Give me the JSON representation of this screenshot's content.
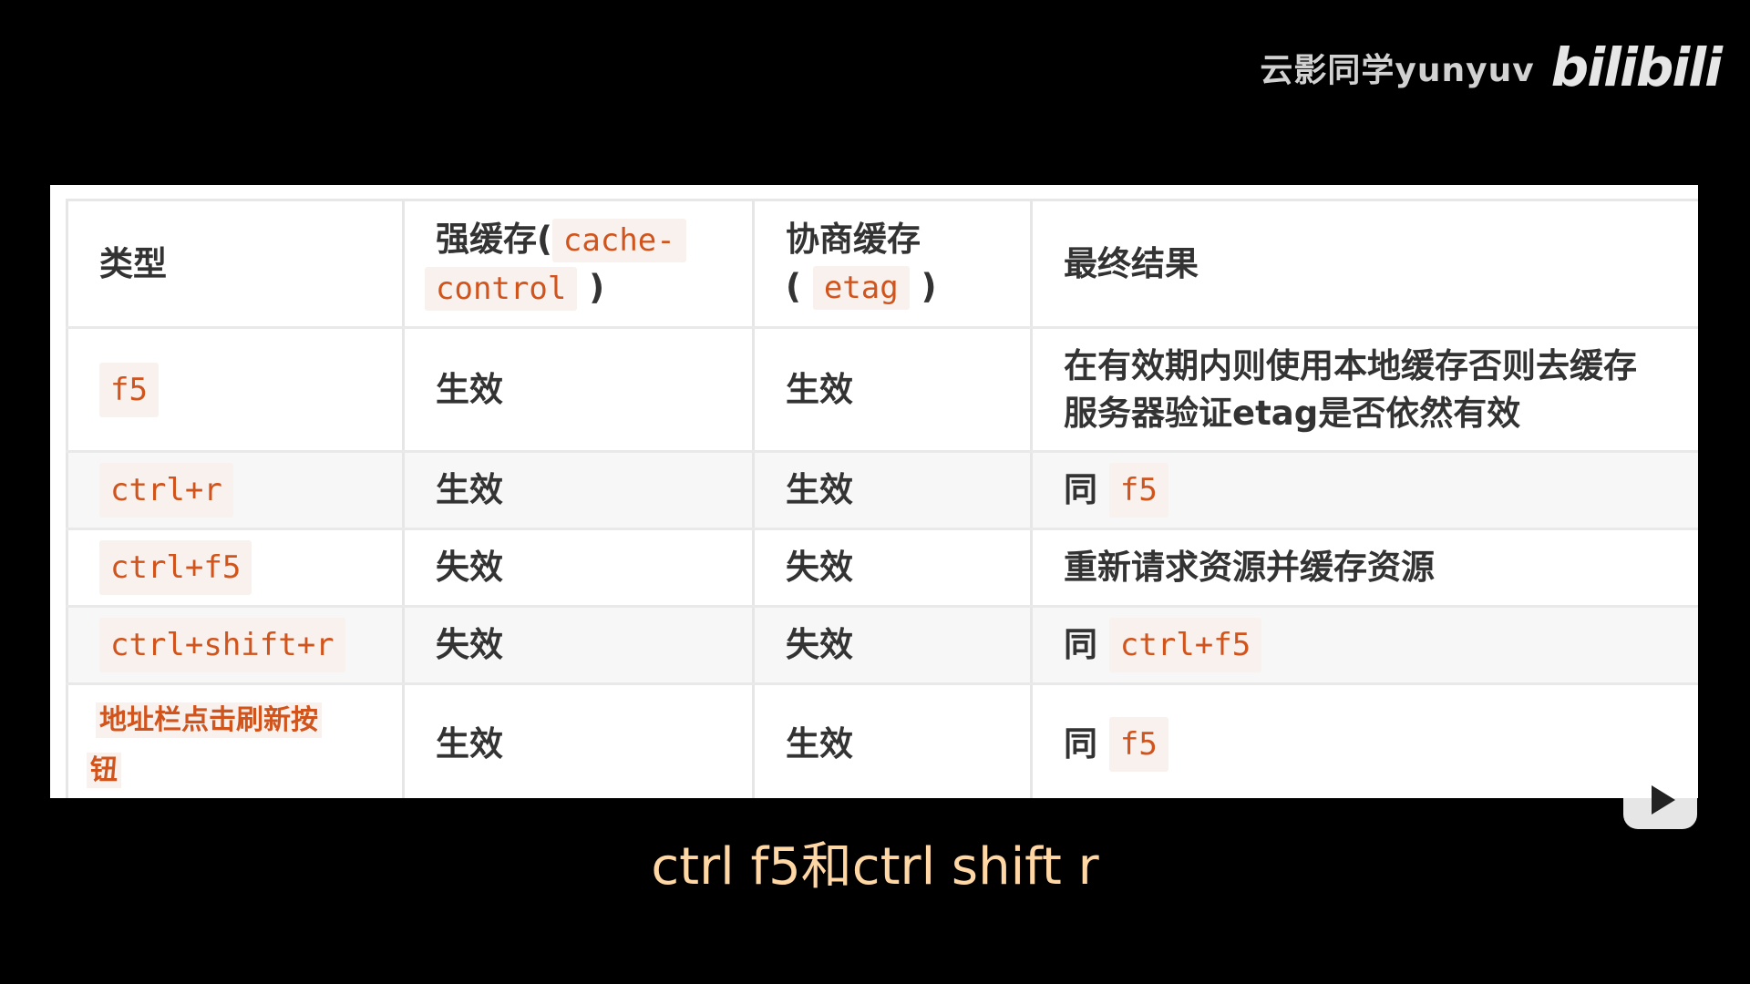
{
  "watermark": {
    "author": "云影同学yunyuv",
    "logo": "bilibili"
  },
  "table": {
    "headers": {
      "type": "类型",
      "strong_prefix": "强缓存(",
      "strong_code_a": "cache-",
      "strong_code_b": "control",
      "strong_suffix": ")",
      "negotiate_text": "协商缓存",
      "negotiate_open": "(",
      "negotiate_code": "etag",
      "negotiate_close": ")",
      "result": "最终结果"
    },
    "rows": [
      {
        "key": "f5",
        "strong": "生效",
        "negotiate": "生效",
        "result_line1": "在有效期内则使用本地缓存否则去缓存",
        "result_line2": "服务器验证etag是否依然有效"
      },
      {
        "key": "ctrl+r",
        "strong": "生效",
        "negotiate": "生效",
        "result_prefix": "同",
        "result_code": "f5"
      },
      {
        "key": "ctrl+f5",
        "strong": "失效",
        "negotiate": "失效",
        "result_text": "重新请求资源并缓存资源"
      },
      {
        "key": "ctrl+shift+r",
        "strong": "失效",
        "negotiate": "失效",
        "result_prefix": "同",
        "result_code": "ctrl+f5"
      },
      {
        "key_line1": "地址栏点击刷新按",
        "key_line2": "钮",
        "strong": "生效",
        "negotiate": "生效",
        "result_prefix": "同",
        "result_code": "f5"
      }
    ]
  },
  "subtitle": "ctrl f5和ctrl shift r",
  "colors": {
    "code_text": "#d0541c",
    "code_bg": "#f8f1ee",
    "subtitle": "#ffd7a4"
  },
  "icons": {
    "play": "play-button-icon"
  }
}
